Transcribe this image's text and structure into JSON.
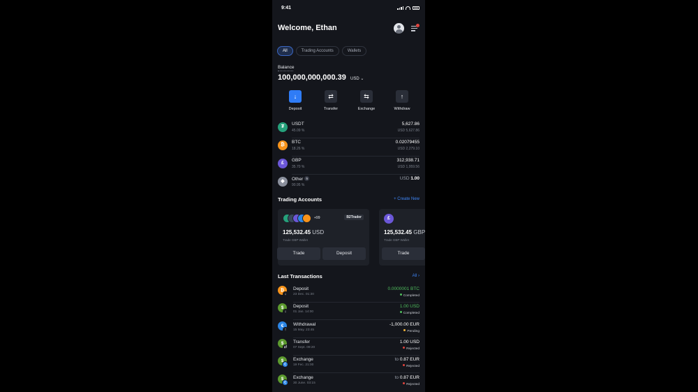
{
  "status_bar": {
    "time": "9:41"
  },
  "header": {
    "title": "Welcome, Ethan"
  },
  "tabs": [
    {
      "label": "All",
      "active": true
    },
    {
      "label": "Trading Accounts",
      "active": false
    },
    {
      "label": "Wallets",
      "active": false
    }
  ],
  "balance": {
    "label": "Balance",
    "amount": "100,000,000,000.39",
    "currency": "USD"
  },
  "actions": [
    {
      "label": "Deposit",
      "icon": "arrow-down-icon"
    },
    {
      "label": "Transfer",
      "icon": "transfer-icon"
    },
    {
      "label": "Exchange",
      "icon": "exchange-icon"
    },
    {
      "label": "Withdraw",
      "icon": "arrow-up-icon"
    }
  ],
  "assets": [
    {
      "symbol": "USDT",
      "share": "45.09 %",
      "amount": "5,627.86",
      "usd": "USD 5,627.86",
      "icon": "tether-icon",
      "color": "#26a17b"
    },
    {
      "symbol": "BTC",
      "share": "18.26 %",
      "amount": "0.02079455",
      "usd": "USD 2,279.10",
      "icon": "bitcoin-icon",
      "color": "#f7931a"
    },
    {
      "symbol": "GBP",
      "share": "35.70 %",
      "amount": "312,938.71",
      "usd": "USD 1,959.56",
      "icon": "pound-icon",
      "color": "#6b57d8"
    },
    {
      "symbol": "Other",
      "share": "90.95 %",
      "amount": "1.00",
      "usd_prefix": "USD",
      "badge": "5",
      "icon": "other-assets-icon",
      "color": "#8a8f9c"
    }
  ],
  "trading": {
    "title": "Trading Accounts",
    "create_label": "+ Create New",
    "cards": [
      {
        "amount": "125,532.45",
        "currency": "USD",
        "note": "Trade GBP Wallet",
        "more": "+99",
        "brand": "B2Trader",
        "trade": "Trade",
        "deposit": "Deposit"
      },
      {
        "amount": "125,532.45",
        "currency": "GBP",
        "note": "Trade GBP Wallet",
        "trade": "Trade"
      }
    ]
  },
  "transactions": {
    "title": "Last Transactions",
    "all_label": "All",
    "items": [
      {
        "type": "Deposit",
        "date": "23 Dec. 01:30",
        "amount": "0.0000001 BTC",
        "status": "Completed",
        "status_color": "#4fbd5d",
        "amount_color": "green",
        "coin_color": "#f7931a",
        "coin": "₿",
        "overlay": "↓"
      },
      {
        "type": "Deposit",
        "date": "01 Jan. 14:00",
        "amount": "1.00 USD",
        "status": "Completed",
        "status_color": "#4fbd5d",
        "amount_color": "green",
        "coin_color": "#5c9a2e",
        "coin": "$",
        "overlay": "↓"
      },
      {
        "type": "Withdrawal",
        "date": "15 May. 23:45",
        "amount": "-1,000.00 EUR",
        "status": "Pending",
        "status_color": "#f0b43a",
        "amount_color": "white",
        "coin_color": "#2c86e6",
        "coin": "€",
        "overlay": "↑"
      },
      {
        "type": "Transfer",
        "date": "07 Sept. 09:20",
        "amount": "1.00 USD",
        "status": "Rejected",
        "status_color": "#e0443e",
        "amount_color": "white",
        "coin_color": "#5c9a2e",
        "coin": "$",
        "overlay": "⇄"
      },
      {
        "type": "Exchange",
        "date": "19 Fec. 21:00",
        "amount_prefix": "to",
        "amount": "0.87 EUR",
        "status": "Rejected",
        "status_color": "#e0443e",
        "amount_color": "white",
        "coin_color": "#5c9a2e",
        "coin": "$",
        "coin2_color": "#2c86e6",
        "coin2": "€"
      },
      {
        "type": "Exchange",
        "date": "30 June. 03:15",
        "amount_prefix": "to",
        "amount": "0.87 EUR",
        "status": "Rejected",
        "status_color": "#e0443e",
        "amount_color": "white",
        "coin_color": "#5c9a2e",
        "coin": "$",
        "coin2_color": "#2c86e6",
        "coin2": "€"
      }
    ]
  }
}
